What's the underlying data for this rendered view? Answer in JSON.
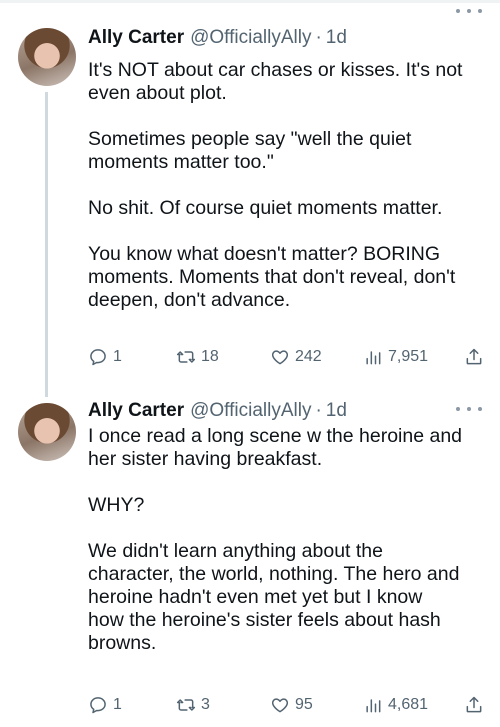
{
  "tweets": [
    {
      "name": "Ally Carter",
      "handle": "@OfficiallyAlly",
      "separator": "·",
      "time": "1d",
      "lines": [
        "It's NOT about car chases or kisses. It's not",
        "even about plot.",
        "",
        "Sometimes people say \"well the quiet",
        "moments matter too.\"",
        "",
        "No shit. Of course quiet moments matter.",
        "",
        "You know what doesn't matter? BORING",
        "moments. Moments that don't reveal, don't",
        "deepen, don't advance."
      ],
      "replies": "1",
      "retweets": "18",
      "likes": "242",
      "views": "7,951"
    },
    {
      "name": "Ally Carter",
      "handle": "@OfficiallyAlly",
      "separator": "·",
      "time": "1d",
      "lines": [
        "I once read a long scene w the heroine and",
        "her sister having breakfast.",
        "",
        "WHY?",
        "",
        "We didn't learn anything about the",
        "character, the world, nothing. The hero and",
        "heroine hadn't even met yet but I know",
        "how the heroine's sister feels about hash",
        "browns."
      ],
      "replies": "1",
      "retweets": "3",
      "likes": "95",
      "views": "4,681"
    }
  ],
  "icons": {
    "reply": "reply-icon",
    "retweet": "retweet-icon",
    "like": "heart-icon",
    "views": "views-icon",
    "share": "share-icon",
    "more": "more-icon"
  },
  "colors": {
    "text": "#0f1419",
    "muted": "#536471",
    "thread_line": "#cfd9de"
  }
}
